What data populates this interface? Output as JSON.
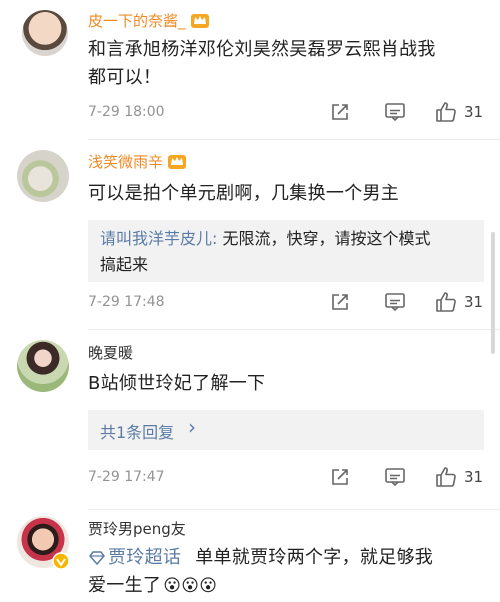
{
  "comments": [
    {
      "username": "皮一下的奈酱_",
      "text_line1": "和言承旭杨洋邓伦刘昊然吴磊罗云熙肖战我",
      "text_line2": "都可以！",
      "time": "7-29 18:00",
      "likes": "31"
    },
    {
      "username": "浅笑微雨辛",
      "text": "可以是拍个单元剧啊，几集换一个男主",
      "reply": {
        "author": "请叫我洋芋皮儿:",
        "text_line1": " 无限流，快穿，请按这个模式",
        "text_line2": "搞起来"
      },
      "time": "7-29 17:48",
      "likes": "31"
    },
    {
      "username": "晚夏暖",
      "text": "B站倾世玲妃了解一下",
      "replies_link": "共1条回复",
      "replies_chevron": "›",
      "time": "7-29 17:47",
      "likes": "31"
    },
    {
      "username": "贾玲男peng友",
      "topic": "贾玲超话",
      "text_line1": "单单就贾玲两个字，就足够我",
      "text_line2": "爱一生了",
      "emoji": "😮😮😮"
    }
  ],
  "colors": {
    "orange_username": "#f08a24",
    "link_blue": "#5b7ba6",
    "time_gray": "#939393",
    "quote_bg": "#f2f2f2"
  }
}
